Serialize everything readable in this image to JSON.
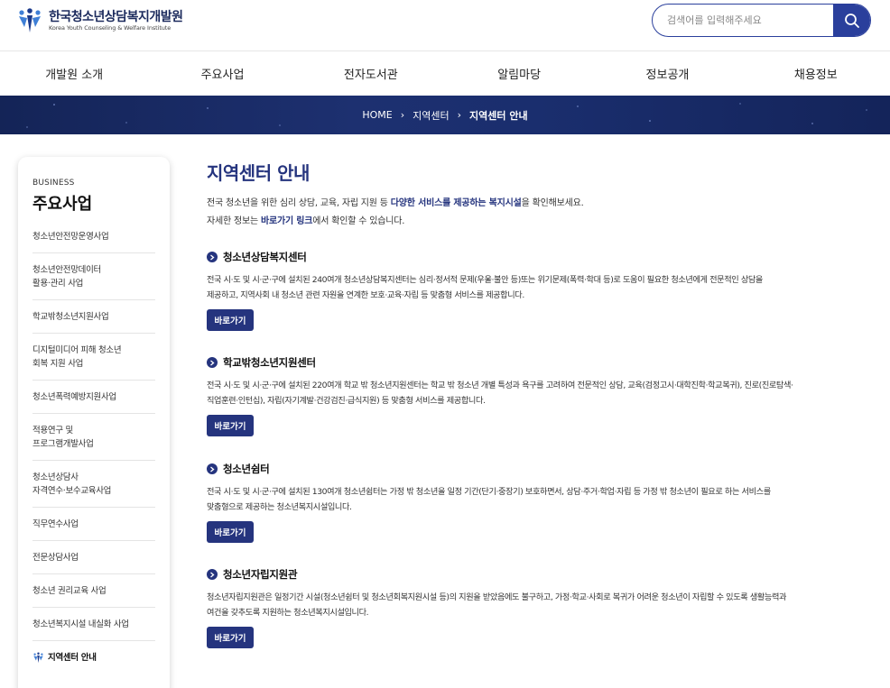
{
  "header": {
    "logo_ko": "한국청소년상담복지개발원",
    "logo_en": "Korea Youth Counseling & Welfare Institute",
    "search_placeholder": "검색어를 입력해주세요"
  },
  "gnb": [
    "개발원 소개",
    "주요사업",
    "전자도서관",
    "알림마당",
    "정보공개",
    "채용정보"
  ],
  "breadcrumb": {
    "home": "HOME",
    "sep": "›",
    "level1": "지역센터",
    "current": "지역센터 안내"
  },
  "sidebar": {
    "eyebrow": "BUSINESS",
    "title": "주요사업",
    "items": [
      {
        "label": [
          "청소년안전망운영사업"
        ]
      },
      {
        "label": [
          "청소년안전망데이터",
          "활용·관리 사업"
        ]
      },
      {
        "label": [
          "학교밖청소년지원사업"
        ]
      },
      {
        "label": [
          "디지털미디어 피해 청소년",
          "회복 지원 사업"
        ]
      },
      {
        "label": [
          "청소년폭력예방지원사업"
        ]
      },
      {
        "label": [
          "적용연구 및",
          "프로그램개발사업"
        ]
      },
      {
        "label": [
          "청소년상담사",
          "자격연수·보수교육사업"
        ]
      },
      {
        "label": [
          "직무연수사업"
        ]
      },
      {
        "label": [
          "전문상담사업"
        ]
      },
      {
        "label": [
          "청소년 권리교육 사업"
        ]
      },
      {
        "label": [
          "청소년복지시설 내실화 사업"
        ]
      }
    ],
    "active": "지역센터 안내"
  },
  "main": {
    "title": "지역센터 안내",
    "intro1_pre": "전국 청소년을 위한 심리 상담, 교육, 자립 지원 등 ",
    "intro1_strong": "다양한 서비스를 제공하는 복지시설",
    "intro1_post": "을 확인해보세요.",
    "intro2_pre": "자세한 정보는 ",
    "intro2_strong": "바로가기 링크",
    "intro2_post": "에서 확인할 수 있습니다.",
    "button_label": "바로가기",
    "sections": [
      {
        "title": "청소년상담복지센터",
        "desc": [
          "전국 시·도 및 시·군·구에 설치된 240여개 청소년상담복지센터는 심리·정서적 문제(우울·불안 등)또는 위기문제(폭력·학대 등)로 도움이 필요한 청소년에게 전문적인 상담을",
          "제공하고, 지역사회 내 청소년 관련 자원을 연계한 보호·교육·자립 등 맞춤형 서비스를 제공합니다."
        ]
      },
      {
        "title": "학교밖청소년지원센터",
        "desc": [
          "전국 시·도 및 시·군·구에 설치된 220여개 학교 밖 청소년지원센터는 학교 밖 청소년 개별 특성과 욕구를 고려하여 전문적인 상담, 교육(검정고시·대학진학·학교복귀), 진로(진로탐색·",
          "직업훈련·인턴십), 자립(자기계발·건강검진·급식지원) 등 맞춤형 서비스를 제공합니다."
        ]
      },
      {
        "title": "청소년쉼터",
        "desc": [
          "전국 시·도 및 시·군·구에 설치된 130여개 청소년쉼터는 가정 밖 청소년을 일정 기간(단기·중장기) 보호하면서, 상담·주거·학업·자립 등 가정 밖 청소년이 필요로 하는 서비스를",
          "맞춤형으로 제공하는 청소년복지시설입니다."
        ]
      },
      {
        "title": "청소년자립지원관",
        "desc": [
          "청소년자립지원관은 일정기간 시설(청소년쉼터 및 청소년회복지원시설 등)의 지원을 받았음에도 불구하고, 가정·학교·사회로 복귀가 어려운 청소년이 자립할 수 있도록 생활능력과",
          "여건을 갖추도록 지원하는 청소년복지시설입니다."
        ]
      }
    ]
  },
  "colors": {
    "brand_navy": "#25347e",
    "search_blue": "#2a3f9c",
    "banner": "#1a2e6e"
  }
}
